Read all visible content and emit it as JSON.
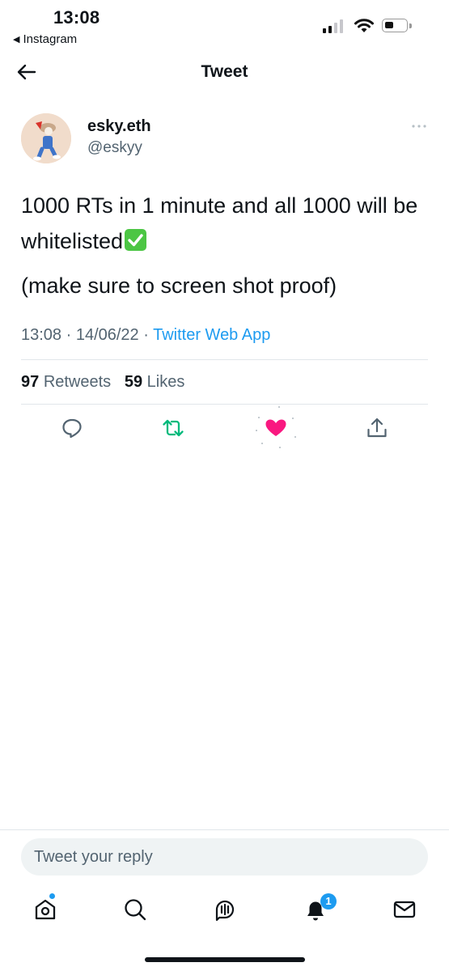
{
  "status_bar": {
    "time": "13:08",
    "back_app": "Instagram",
    "back_glyph": "◀"
  },
  "header": {
    "title": "Tweet"
  },
  "tweet": {
    "display_name": "esky.eth",
    "handle": "@eskyy",
    "text_line1": "1000 RTs in 1 minute and all 1000 will be whitelisted",
    "text_line2": "(make sure to screen shot proof)",
    "timestamp": "13:08 · 14/06/22 · ",
    "source": "Twitter Web App",
    "retweets_count": "97",
    "retweets_label": "Retweets",
    "likes_count": "59",
    "likes_label": "Likes",
    "liked": true
  },
  "reply": {
    "placeholder": "Tweet your reply"
  },
  "bottom_nav": {
    "items": [
      "home-icon",
      "search-icon",
      "spaces-icon",
      "notifications-icon",
      "messages-icon"
    ],
    "notifications_badge": "1"
  },
  "colors": {
    "accent": "#1d9bf0",
    "like": "#f91880",
    "retweet": "#00ba7c",
    "muted": "#536471"
  }
}
